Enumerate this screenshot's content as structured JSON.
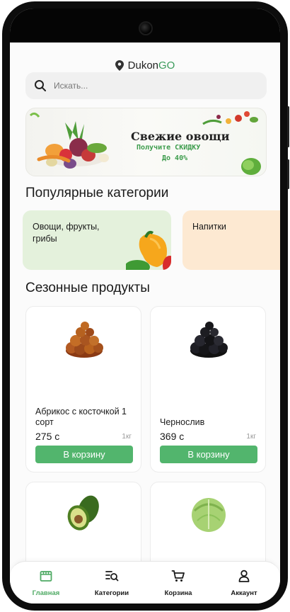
{
  "header": {
    "brand_prefix": "Dukon",
    "brand_accent": "GO"
  },
  "search": {
    "placeholder": "Искать..."
  },
  "banner": {
    "title": "Свежие овощи",
    "subtitle": "Получите СКИДКУ",
    "discount": "До 40%"
  },
  "sections": {
    "popular": "Популярные категории",
    "seasonal": "Сезонные продукты"
  },
  "categories": [
    {
      "label": "Овощи, фрукты, грибы",
      "color": "#e4f1dc"
    },
    {
      "label": "Напитки",
      "color": "#fde9d2"
    }
  ],
  "products": [
    {
      "name": "Абрикос с косточкой 1 сорт",
      "price": "275 с",
      "unit": "1кг",
      "cart_label": "В корзину"
    },
    {
      "name": "Чернослив",
      "price": "369 с",
      "unit": "1кг",
      "cart_label": "В корзину"
    },
    {
      "name": "",
      "price": "",
      "unit": ""
    },
    {
      "name": "",
      "price": "",
      "unit": ""
    }
  ],
  "tabs": [
    {
      "label": "Главная",
      "icon": "store-icon",
      "active": true
    },
    {
      "label": "Категории",
      "icon": "list-search-icon",
      "active": false
    },
    {
      "label": "Корзина",
      "icon": "cart-icon",
      "active": false
    },
    {
      "label": "Аккаунт",
      "icon": "user-icon",
      "active": false
    }
  ],
  "colors": {
    "accent": "#52b56d",
    "active_tab": "#4faa64"
  }
}
